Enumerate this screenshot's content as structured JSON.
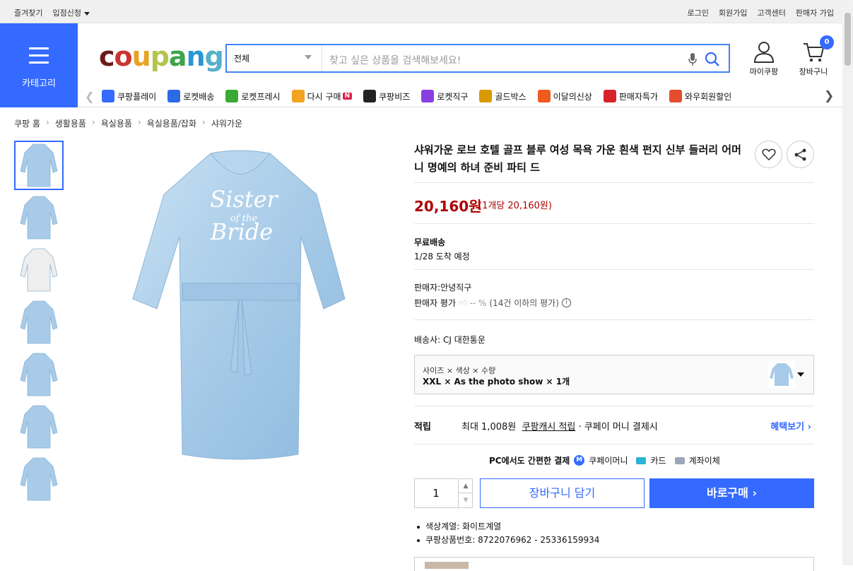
{
  "topbar": {
    "bookmark": "즐겨찾기",
    "store_apply": "입점신청",
    "login": "로그인",
    "signup": "회원가입",
    "cs": "고객센터",
    "seller_signup": "판매자 가입"
  },
  "category": {
    "label": "카테고리"
  },
  "logo": {
    "letters": [
      "c",
      "o",
      "u",
      "p",
      "a",
      "n",
      "g"
    ],
    "colors": [
      "#6b1b1b",
      "#c9342f",
      "#e7a324",
      "#b4c34b",
      "#3ea34b",
      "#2b96d6",
      "#56b0c9"
    ]
  },
  "search": {
    "category": "전체",
    "placeholder": "찾고 싶은 상품을 검색해보세요!"
  },
  "header": {
    "mypage": "마이쿠팡",
    "cart": "장바구니",
    "cart_count": "0"
  },
  "quicknav": [
    {
      "label": "쿠팡플레이",
      "icon": "play-icon",
      "color": "#346aff"
    },
    {
      "label": "로켓배송",
      "icon": "rocket-icon",
      "color": "#2c6ae6"
    },
    {
      "label": "로켓프레시",
      "icon": "rocket-fresh-icon",
      "color": "#3aaa35"
    },
    {
      "label": "다시 구매",
      "icon": "rebuy-icon",
      "color": "#f1a321"
    },
    {
      "label": "쿠팡비즈",
      "icon": "biz-icon",
      "color": "#222222"
    },
    {
      "label": "로켓직구",
      "icon": "global-rocket-icon",
      "color": "#8a3fe0"
    },
    {
      "label": "골드박스",
      "icon": "gold-box-icon",
      "color": "#d99a00"
    },
    {
      "label": "이달의신상",
      "icon": "new-bag-icon",
      "color": "#ef5a1e"
    },
    {
      "label": "판매자특가",
      "icon": "discount-icon",
      "color": "#d6232a"
    },
    {
      "label": "와우회원할인",
      "icon": "wow-icon",
      "color": "#e44d2c"
    }
  ],
  "rebuy_badge": "N",
  "breadcrumb": [
    "쿠팡 홈",
    "생활용품",
    "욕실용품",
    "욕실용품/잡화",
    "샤워가운"
  ],
  "product": {
    "title": "샤워가운 로브 호텔 골프 블루 여성 목욕 가운 흰색 펀지 신부 들러리 어머니 명예의 하녀 준비 파티 드",
    "image_text_1": "Sister",
    "image_text_2": "of the",
    "image_text_3": "Bride",
    "price": "20,160원",
    "unit_price": "(1개당 20,160원)",
    "shipping": "무료배송",
    "arrival": "1/28 도착 예정",
    "seller": "판매자:안녕직구",
    "seller_rating_label": "판매자 평가",
    "seller_rating_value": "-- %",
    "seller_rating_note": "(14건 이하의 평가)",
    "delivery": "배송사:  CJ 대한통운",
    "option_head": "사이즈 × 색상 × 수량",
    "option_value": "XXL × As the photo show × 1개",
    "reward_key": "적립",
    "reward_text_1": "최대 1,008원",
    "reward_text_2": "쿠팡캐시 적립",
    "reward_text_3": "· 쿠페이 머니 결제시",
    "reward_link": "혜택보기",
    "pay_title": "PC에서도 간편한 결제",
    "pay_methods": [
      "쿠페이머니",
      "카드",
      "계좌이체"
    ],
    "quantity": "1",
    "add_to_cart": "장바구니 담기",
    "buy_now": "바로구매",
    "attributes": [
      "색상계열: 화이트계열",
      "쿠팡상품번호: 8722076962 - 25336159934"
    ]
  }
}
